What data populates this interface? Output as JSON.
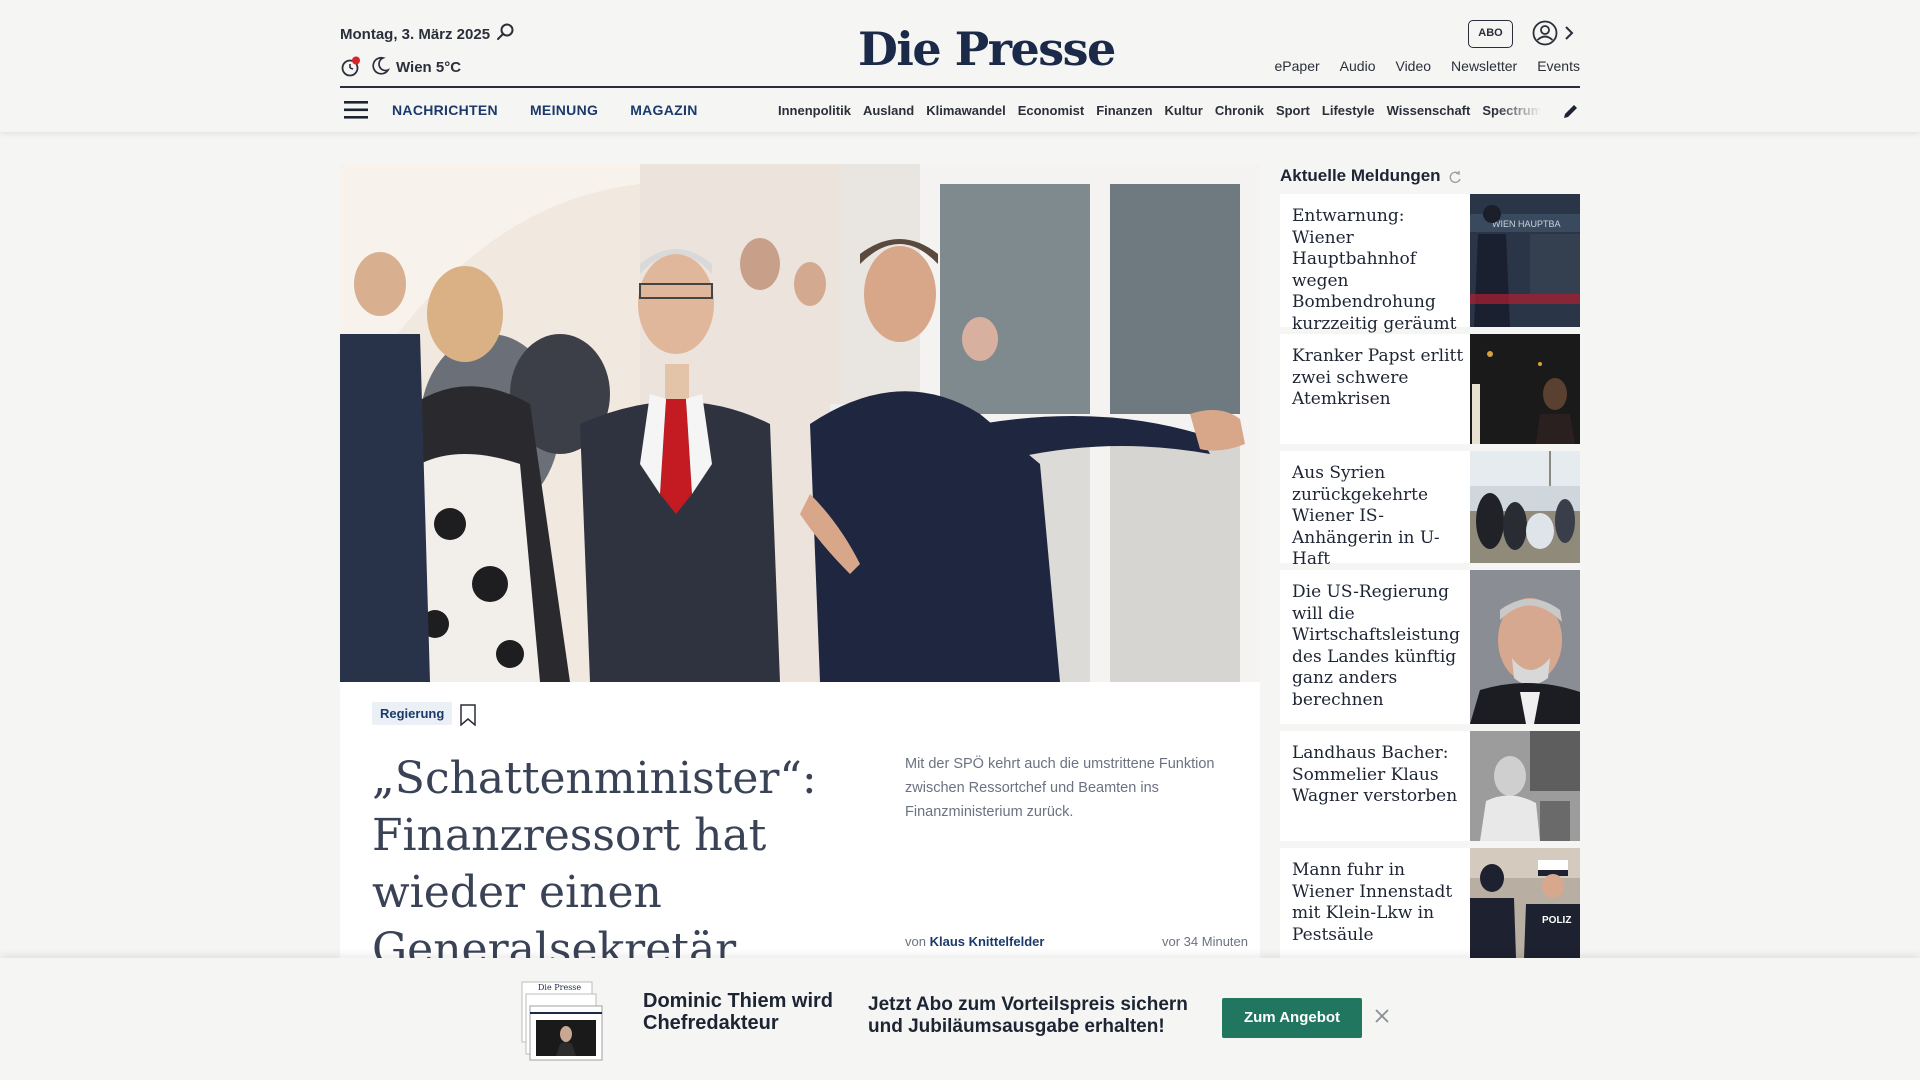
{
  "header": {
    "date": "Montag, 3. März 2025",
    "weather": "Wien 5°C",
    "logo": "Die Presse",
    "abo_label": "ABO",
    "top_links": [
      "ePaper",
      "Audio",
      "Video",
      "Newsletter",
      "Events"
    ]
  },
  "nav": {
    "main": [
      "NACHRICHTEN",
      "MEINUNG",
      "MAGAZIN"
    ],
    "sub": [
      "Innenpolitik",
      "Ausland",
      "Klimawandel",
      "Economist",
      "Finanzen",
      "Kultur",
      "Chronik",
      "Sport",
      "Lifestyle",
      "Wissenschaft",
      "Spectrum"
    ]
  },
  "hero": {
    "tag": "Regierung",
    "headline": "„Schattenminister“: Finanzressort hat wieder einen Generalsekretär",
    "teaser": "Mit der SPÖ kehrt auch die umstrittene Funktion zwischen Ressortchef und Beamten ins Finanzministerium zurück.",
    "byline_prefix": "von",
    "author": "Klaus Knittelfelder",
    "time_ago": "vor 34 Minuten"
  },
  "sidebar": {
    "title": "Aktuelle Meldungen",
    "items": [
      {
        "title": "Entwarnung: Wiener Hauptbahnhof wegen Bombendrohung kurzzeitig geräumt",
        "thumb_text": "WIEN HAUPTBA"
      },
      {
        "title": "Kranker Papst erlitt zwei schwere Atemkrisen"
      },
      {
        "title": "Aus Syrien zurückgekehrte Wiener IS-Anhängerin in U-Haft"
      },
      {
        "title": "Die US-Regierung will die Wirtschaftsleistung des Landes künftig ganz anders berechnen"
      },
      {
        "title": "Landhaus Bacher: Sommelier Klaus Wagner verstorben"
      },
      {
        "title": "Mann fuhr in Wiener Innenstadt mit Klein-Lkw in Pestsäule",
        "thumb_text": "POLIZ"
      }
    ]
  },
  "promo": {
    "line_a": "Dominic Thiem wird Chefredakteur",
    "line_b": "Jetzt Abo zum Vorteilspreis sichern und Jubiläumsausgabe erhalten!",
    "button": "Zum Angebot",
    "mini_logo": "Die Presse"
  },
  "colors": {
    "brand_navy": "#1b2a49",
    "nav_blue": "#1b3a6b",
    "cta_green": "#217660",
    "background": "#f5f5f3",
    "notification_red": "#d7232a"
  }
}
